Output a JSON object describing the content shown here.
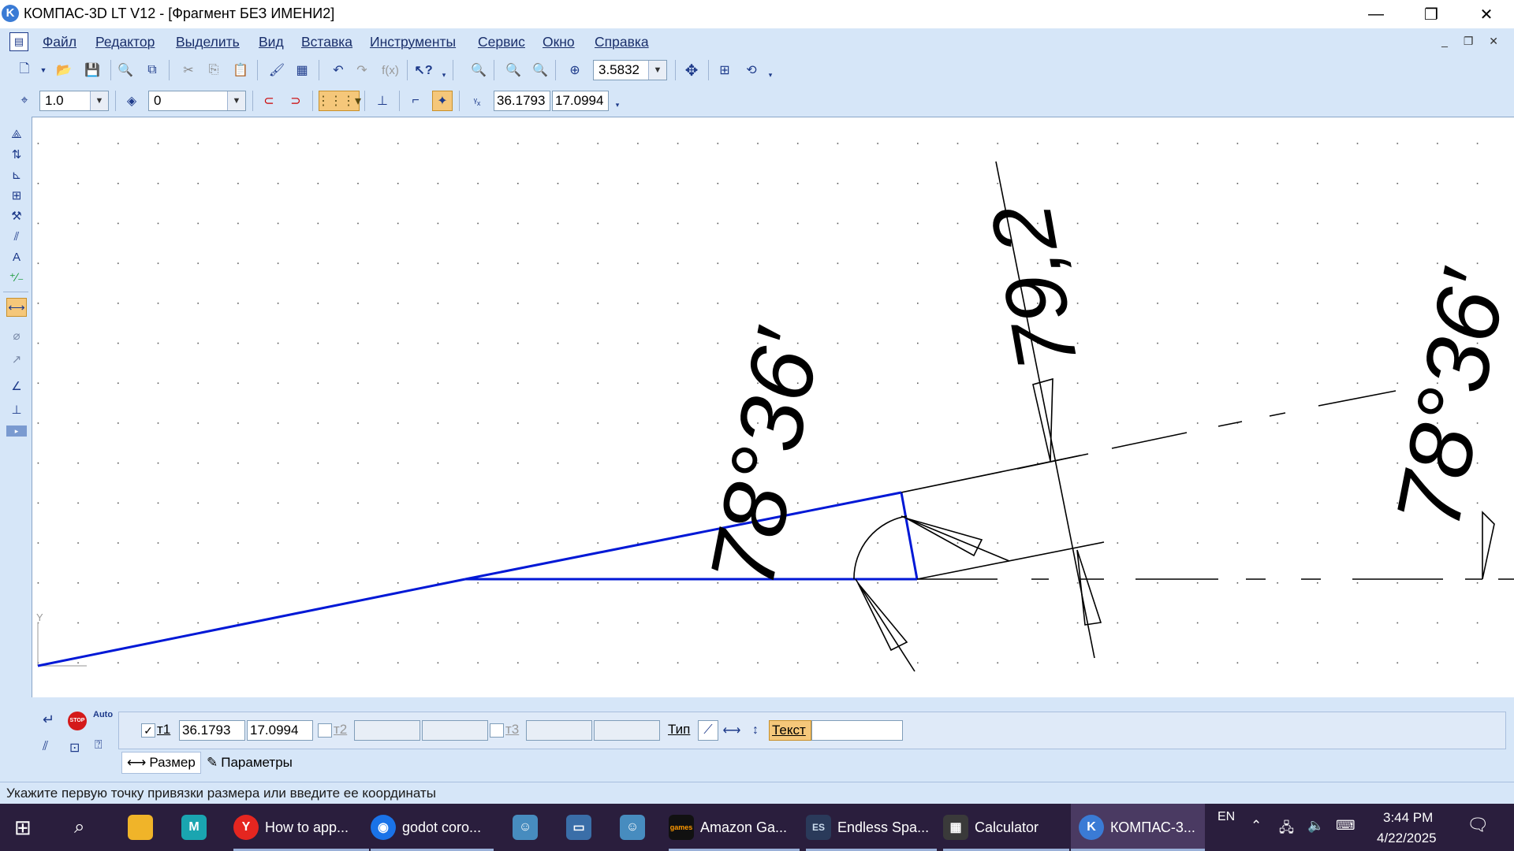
{
  "window": {
    "app_logo": "K",
    "title": "КОМПАС-3D LT V12 - [Фрагмент БЕЗ ИМЕНИ2]",
    "controls": [
      "—",
      "❐",
      "✕"
    ],
    "mdi_controls": "_ ❐ ✕"
  },
  "menu": {
    "items": [
      "Файл",
      "Редактор",
      "Выделить",
      "Вид",
      "Вставка",
      "Инструменты",
      "Сервис",
      "Окно",
      "Справка"
    ]
  },
  "toolbar_main": {
    "fx_label": "f(x)",
    "zoom_value": "3.5832"
  },
  "toolbar_current": {
    "step_value": "1.0",
    "layer_value": "0",
    "coord_x": "36.1793",
    "coord_y": "17.0994"
  },
  "drawing": {
    "dim_linear_value": "79,2",
    "dim_angle_value": "78°36′",
    "dim_angle_value_2": "78°36′",
    "axis_label": "Y"
  },
  "property_bar": {
    "auto_label": "Auto",
    "stop_label": "STOP",
    "t1_label": "т1",
    "t1_x": "36.1793",
    "t1_y": "17.0994",
    "t2_label": "т2",
    "t3_label": "т3",
    "type_label": "Тип",
    "text_label": "Текст",
    "text_value": "",
    "tab_size": "Размер",
    "tab_params": "Параметры"
  },
  "status": {
    "text": "Укажите первую точку привязки размера или введите ее координаты"
  },
  "taskbar": {
    "apps": [
      {
        "label": "How to app...",
        "icon": "Y",
        "color": "#e52620"
      },
      {
        "label": "godot coro...",
        "icon": "◉",
        "color": "#1a73e8"
      },
      {
        "label": "Amazon Ga...",
        "icon": "games",
        "color": "#111111"
      },
      {
        "label": "Endless Spa...",
        "icon": "ES",
        "color": "#2a3a5a"
      },
      {
        "label": "Calculator",
        "icon": "▦",
        "color": "#3a3a3a"
      },
      {
        "label": "КОМПАС-3...",
        "icon": "K",
        "color": "#3a7bd5"
      }
    ],
    "lang": "EN",
    "time": "3:44 PM",
    "date": "4/22/2025"
  }
}
